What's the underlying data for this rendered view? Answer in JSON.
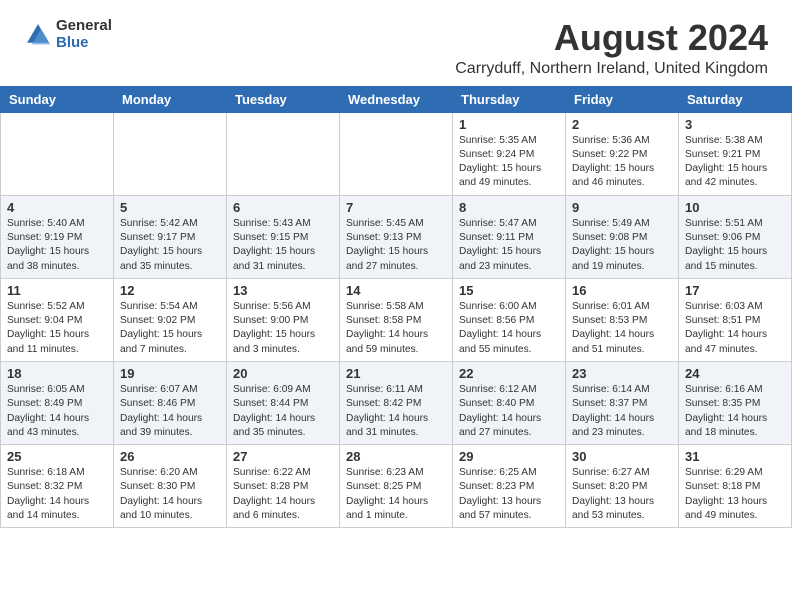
{
  "header": {
    "logo_general": "General",
    "logo_blue": "Blue",
    "title": "August 2024",
    "subtitle": "Carryduff, Northern Ireland, United Kingdom"
  },
  "days_of_week": [
    "Sunday",
    "Monday",
    "Tuesday",
    "Wednesday",
    "Thursday",
    "Friday",
    "Saturday"
  ],
  "weeks": [
    [
      {
        "day": "",
        "info": ""
      },
      {
        "day": "",
        "info": ""
      },
      {
        "day": "",
        "info": ""
      },
      {
        "day": "",
        "info": ""
      },
      {
        "day": "1",
        "info": "Sunrise: 5:35 AM\nSunset: 9:24 PM\nDaylight: 15 hours\nand 49 minutes."
      },
      {
        "day": "2",
        "info": "Sunrise: 5:36 AM\nSunset: 9:22 PM\nDaylight: 15 hours\nand 46 minutes."
      },
      {
        "day": "3",
        "info": "Sunrise: 5:38 AM\nSunset: 9:21 PM\nDaylight: 15 hours\nand 42 minutes."
      }
    ],
    [
      {
        "day": "4",
        "info": "Sunrise: 5:40 AM\nSunset: 9:19 PM\nDaylight: 15 hours\nand 38 minutes."
      },
      {
        "day": "5",
        "info": "Sunrise: 5:42 AM\nSunset: 9:17 PM\nDaylight: 15 hours\nand 35 minutes."
      },
      {
        "day": "6",
        "info": "Sunrise: 5:43 AM\nSunset: 9:15 PM\nDaylight: 15 hours\nand 31 minutes."
      },
      {
        "day": "7",
        "info": "Sunrise: 5:45 AM\nSunset: 9:13 PM\nDaylight: 15 hours\nand 27 minutes."
      },
      {
        "day": "8",
        "info": "Sunrise: 5:47 AM\nSunset: 9:11 PM\nDaylight: 15 hours\nand 23 minutes."
      },
      {
        "day": "9",
        "info": "Sunrise: 5:49 AM\nSunset: 9:08 PM\nDaylight: 15 hours\nand 19 minutes."
      },
      {
        "day": "10",
        "info": "Sunrise: 5:51 AM\nSunset: 9:06 PM\nDaylight: 15 hours\nand 15 minutes."
      }
    ],
    [
      {
        "day": "11",
        "info": "Sunrise: 5:52 AM\nSunset: 9:04 PM\nDaylight: 15 hours\nand 11 minutes."
      },
      {
        "day": "12",
        "info": "Sunrise: 5:54 AM\nSunset: 9:02 PM\nDaylight: 15 hours\nand 7 minutes."
      },
      {
        "day": "13",
        "info": "Sunrise: 5:56 AM\nSunset: 9:00 PM\nDaylight: 15 hours\nand 3 minutes."
      },
      {
        "day": "14",
        "info": "Sunrise: 5:58 AM\nSunset: 8:58 PM\nDaylight: 14 hours\nand 59 minutes."
      },
      {
        "day": "15",
        "info": "Sunrise: 6:00 AM\nSunset: 8:56 PM\nDaylight: 14 hours\nand 55 minutes."
      },
      {
        "day": "16",
        "info": "Sunrise: 6:01 AM\nSunset: 8:53 PM\nDaylight: 14 hours\nand 51 minutes."
      },
      {
        "day": "17",
        "info": "Sunrise: 6:03 AM\nSunset: 8:51 PM\nDaylight: 14 hours\nand 47 minutes."
      }
    ],
    [
      {
        "day": "18",
        "info": "Sunrise: 6:05 AM\nSunset: 8:49 PM\nDaylight: 14 hours\nand 43 minutes."
      },
      {
        "day": "19",
        "info": "Sunrise: 6:07 AM\nSunset: 8:46 PM\nDaylight: 14 hours\nand 39 minutes."
      },
      {
        "day": "20",
        "info": "Sunrise: 6:09 AM\nSunset: 8:44 PM\nDaylight: 14 hours\nand 35 minutes."
      },
      {
        "day": "21",
        "info": "Sunrise: 6:11 AM\nSunset: 8:42 PM\nDaylight: 14 hours\nand 31 minutes."
      },
      {
        "day": "22",
        "info": "Sunrise: 6:12 AM\nSunset: 8:40 PM\nDaylight: 14 hours\nand 27 minutes."
      },
      {
        "day": "23",
        "info": "Sunrise: 6:14 AM\nSunset: 8:37 PM\nDaylight: 14 hours\nand 23 minutes."
      },
      {
        "day": "24",
        "info": "Sunrise: 6:16 AM\nSunset: 8:35 PM\nDaylight: 14 hours\nand 18 minutes."
      }
    ],
    [
      {
        "day": "25",
        "info": "Sunrise: 6:18 AM\nSunset: 8:32 PM\nDaylight: 14 hours\nand 14 minutes."
      },
      {
        "day": "26",
        "info": "Sunrise: 6:20 AM\nSunset: 8:30 PM\nDaylight: 14 hours\nand 10 minutes."
      },
      {
        "day": "27",
        "info": "Sunrise: 6:22 AM\nSunset: 8:28 PM\nDaylight: 14 hours\nand 6 minutes."
      },
      {
        "day": "28",
        "info": "Sunrise: 6:23 AM\nSunset: 8:25 PM\nDaylight: 14 hours\nand 1 minute."
      },
      {
        "day": "29",
        "info": "Sunrise: 6:25 AM\nSunset: 8:23 PM\nDaylight: 13 hours\nand 57 minutes."
      },
      {
        "day": "30",
        "info": "Sunrise: 6:27 AM\nSunset: 8:20 PM\nDaylight: 13 hours\nand 53 minutes."
      },
      {
        "day": "31",
        "info": "Sunrise: 6:29 AM\nSunset: 8:18 PM\nDaylight: 13 hours\nand 49 minutes."
      }
    ]
  ]
}
